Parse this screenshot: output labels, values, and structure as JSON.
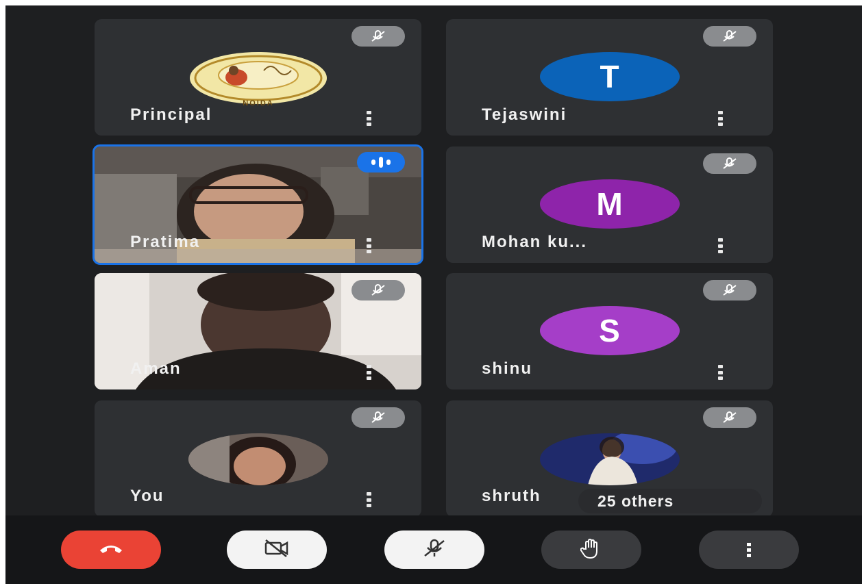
{
  "participants": [
    {
      "name": "Principal",
      "type": "logo",
      "muted": true,
      "logo_text": "NOIDA"
    },
    {
      "name": "Tejaswini",
      "type": "letter",
      "letter": "T",
      "color": "#0b63b8",
      "muted": true
    },
    {
      "name": "Pratima",
      "type": "video",
      "speaking": true
    },
    {
      "name": "Mohan ku...",
      "type": "letter",
      "letter": "M",
      "color": "#8e24aa",
      "muted": true
    },
    {
      "name": "Aman",
      "type": "video",
      "muted": true
    },
    {
      "name": "shinu",
      "type": "letter",
      "letter": "S",
      "color": "#a53ec8",
      "muted": true
    },
    {
      "name": "You",
      "type": "photo",
      "muted": true
    },
    {
      "name": "shruth",
      "type": "photo",
      "muted": true
    }
  ],
  "others_label": "25 others",
  "controls": {
    "leave_color": "#ea4335",
    "items": [
      "end-call-icon",
      "camera-off-icon",
      "mic-off-icon",
      "raise-hand-icon",
      "more-options-icon"
    ]
  }
}
